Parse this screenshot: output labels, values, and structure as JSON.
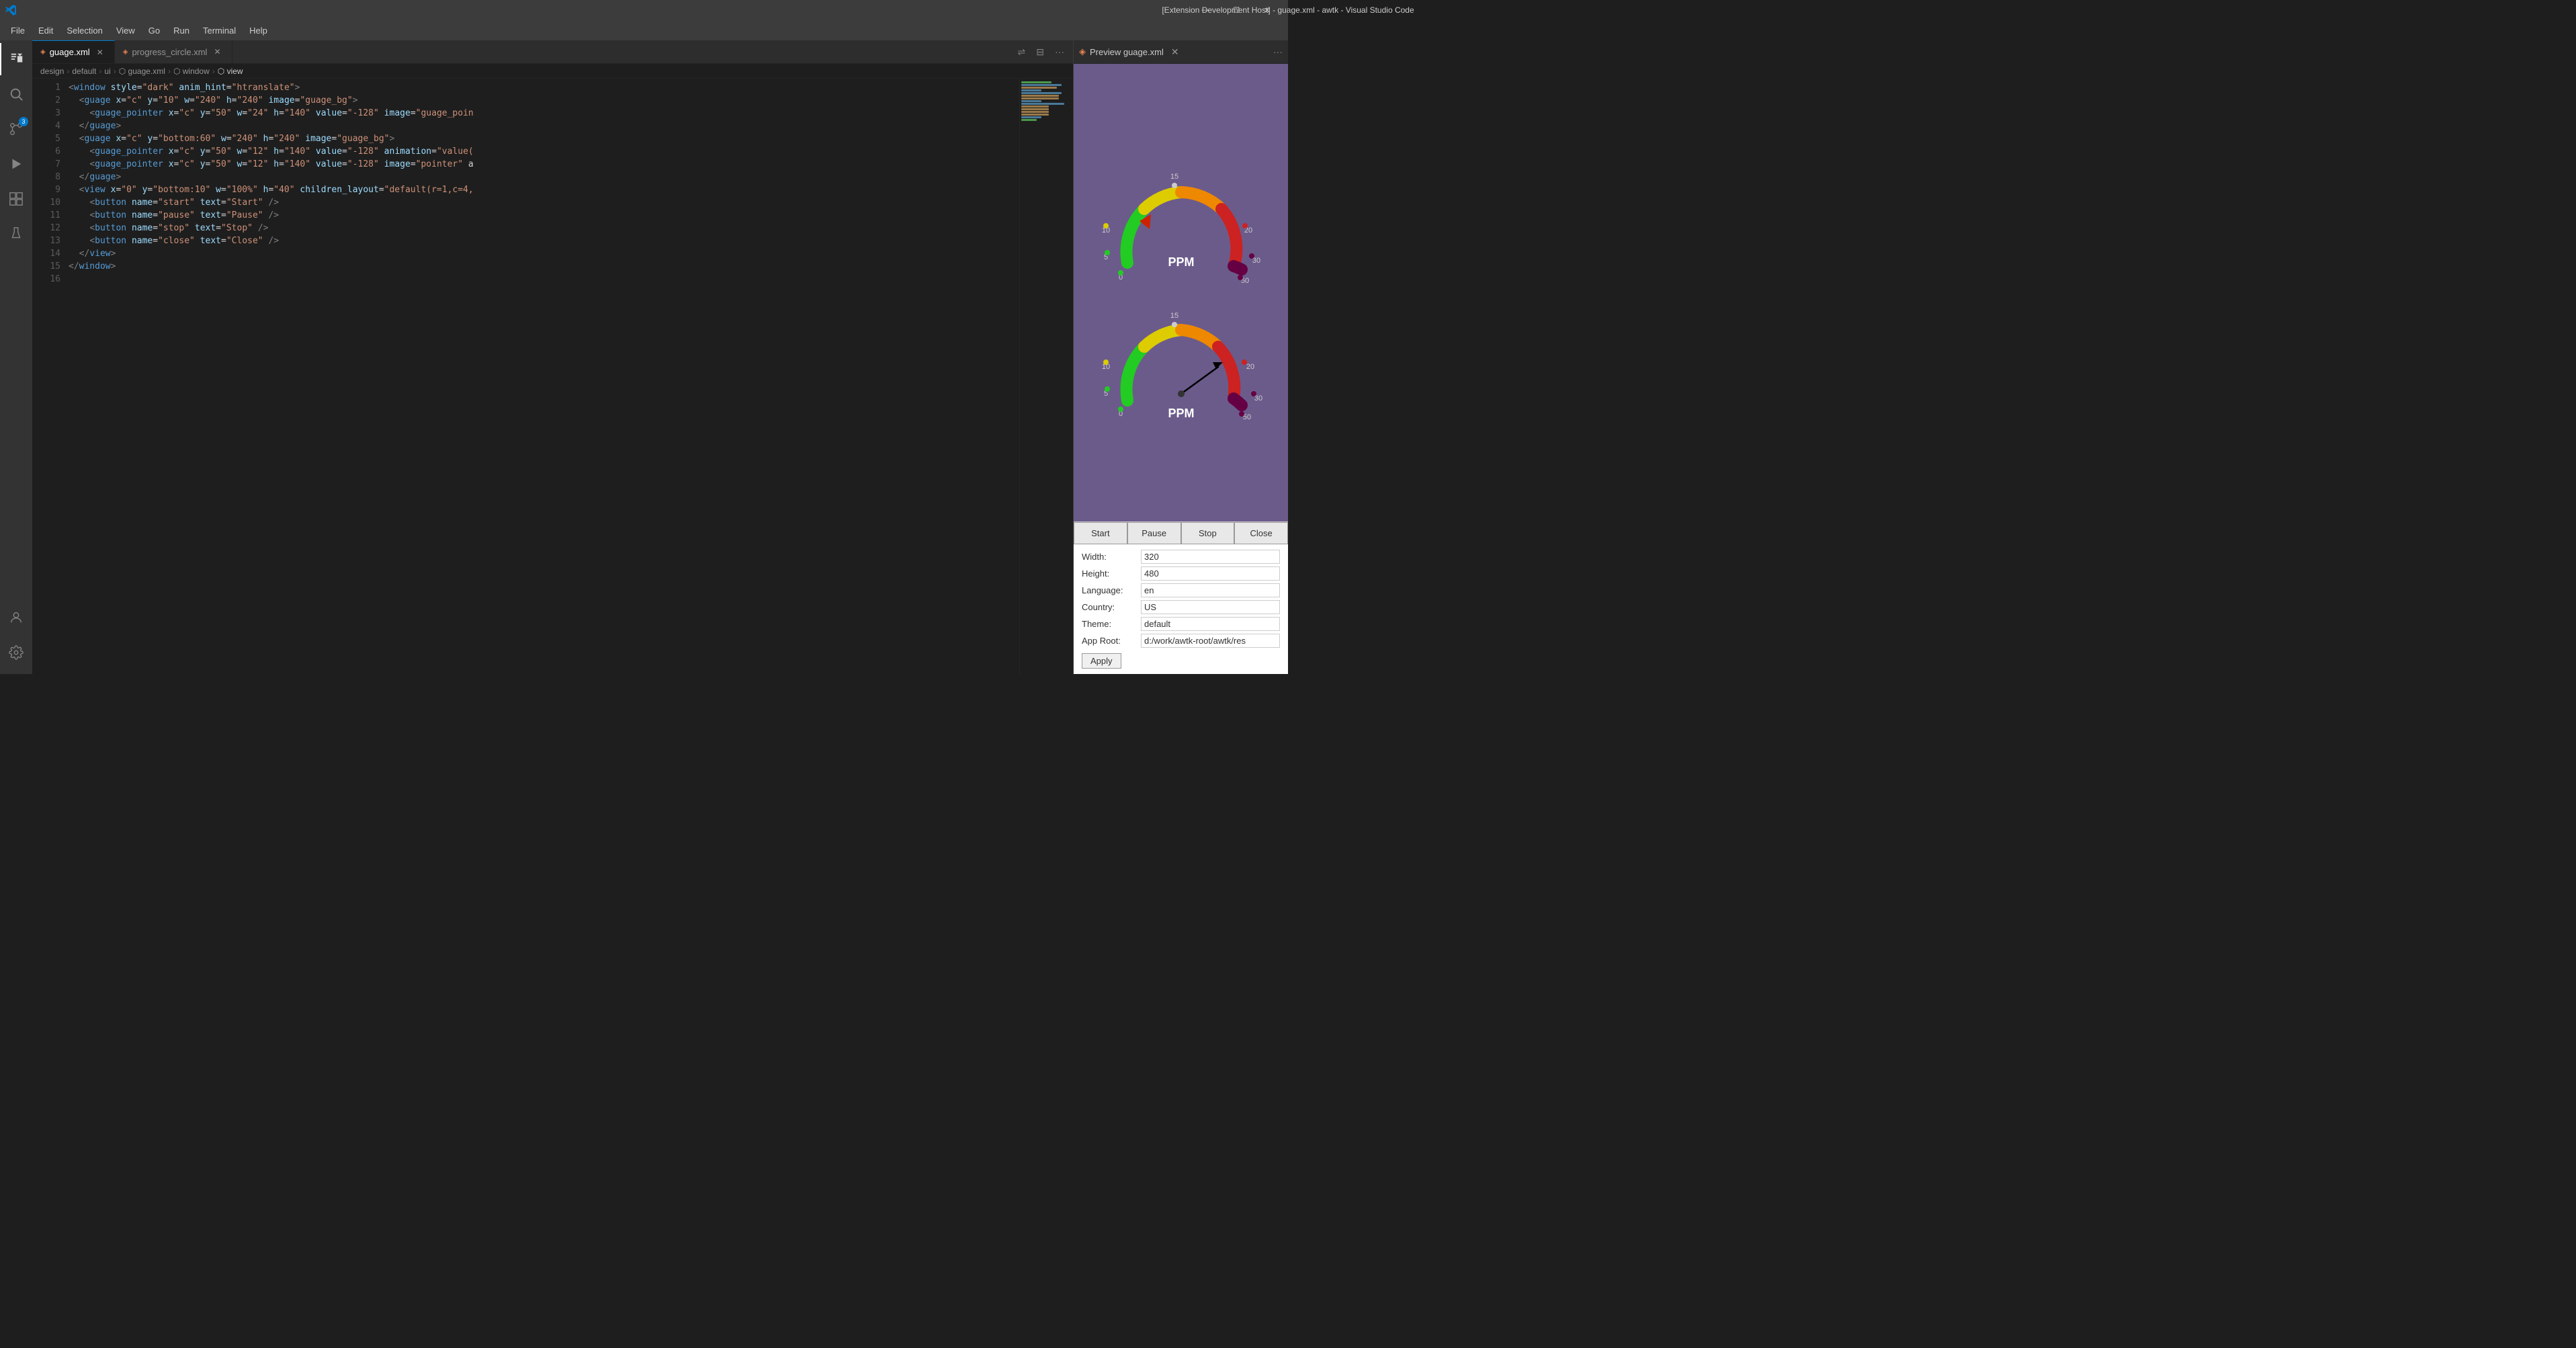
{
  "titleBar": {
    "title": "[Extension Development Host] - guage.xml - awtk - Visual Studio Code",
    "buttons": {
      "minimize": "—",
      "maximize": "❐",
      "close": "✕"
    }
  },
  "menuBar": {
    "items": [
      "File",
      "Edit",
      "Selection",
      "View",
      "Go",
      "Run",
      "Terminal",
      "Help"
    ]
  },
  "activityBar": {
    "icons": [
      {
        "name": "explorer",
        "symbol": "⬜",
        "active": true
      },
      {
        "name": "search",
        "symbol": "🔍"
      },
      {
        "name": "source-control",
        "symbol": "⎇",
        "badge": "3"
      },
      {
        "name": "run-debug",
        "symbol": "▶"
      },
      {
        "name": "extensions",
        "symbol": "⊞"
      },
      {
        "name": "testing",
        "symbol": "⚗"
      }
    ],
    "bottom": [
      {
        "name": "accounts",
        "symbol": "👤"
      },
      {
        "name": "settings",
        "symbol": "⚙"
      }
    ]
  },
  "tabs": [
    {
      "label": "guage.xml",
      "active": true,
      "modified": false
    },
    {
      "label": "progress_circle.xml",
      "active": false,
      "modified": false
    }
  ],
  "breadcrumb": [
    "design",
    "default",
    "ui",
    "guage.xml",
    "window",
    "view"
  ],
  "codeLines": [
    {
      "num": 1,
      "indent": 0,
      "content": "<window style=\"dark\" anim_hint=\"htranslate\">"
    },
    {
      "num": 2,
      "indent": 1,
      "content": "  <guage x=\"c\" y=\"10\" w=\"240\" h=\"240\" image=\"guage_bg\">"
    },
    {
      "num": 3,
      "indent": 2,
      "content": "    <guage_pointer x=\"c\" y=\"50\" w=\"24\" h=\"140\" value=\"-128\" image=\"guage_poin"
    },
    {
      "num": 4,
      "indent": 1,
      "content": "  </guage>"
    },
    {
      "num": 5,
      "indent": 1,
      "content": "  <guage x=\"c\" y=\"bottom:60\" w=\"240\" h=\"240\" image=\"guage_bg\">"
    },
    {
      "num": 6,
      "indent": 2,
      "content": "    <guage_pointer x=\"c\" y=\"50\" w=\"12\" h=\"140\" value=\"-128\" animation=\"value("
    },
    {
      "num": 7,
      "indent": 2,
      "content": "    <guage_pointer x=\"c\" y=\"50\" w=\"12\" h=\"140\" value=\"-128\" image=\"pointer\" a"
    },
    {
      "num": 8,
      "indent": 1,
      "content": "  </guage>"
    },
    {
      "num": 9,
      "indent": 1,
      "content": "  <view x=\"0\" y=\"bottom:10\" w=\"100%\" h=\"40\" children_layout=\"default(r=1,c=4,"
    },
    {
      "num": 10,
      "indent": 2,
      "content": "    <button name=\"start\" text=\"Start\" />"
    },
    {
      "num": 11,
      "indent": 2,
      "content": "    <button name=\"pause\" text=\"Pause\" />"
    },
    {
      "num": 12,
      "indent": 2,
      "content": "    <button name=\"stop\" text=\"Stop\" />"
    },
    {
      "num": 13,
      "indent": 2,
      "content": "    <button name=\"close\" text=\"Close\" />"
    },
    {
      "num": 14,
      "indent": 1,
      "content": "  </view>"
    },
    {
      "num": 15,
      "indent": 0,
      "content": "</window>"
    },
    {
      "num": 16,
      "indent": 0,
      "content": ""
    }
  ],
  "preview": {
    "title": "Preview guage.xml",
    "buttons": {
      "start": "Start",
      "pause": "Pause",
      "stop": "Stop",
      "close": "Close"
    },
    "properties": {
      "width": {
        "label": "Width:",
        "value": "320"
      },
      "height": {
        "label": "Height:",
        "value": "480"
      },
      "language": {
        "label": "Language:",
        "value": "en"
      },
      "country": {
        "label": "Country:",
        "value": "US"
      },
      "theme": {
        "label": "Theme:",
        "value": "default"
      },
      "appRoot": {
        "label": "App Root:",
        "value": "d:/work/awtk-root/awtk/res"
      }
    },
    "applyButton": "Apply"
  },
  "gauges": {
    "top": {
      "ppm": "PPM",
      "ticks": [
        "5",
        "10",
        "15",
        "20",
        "30",
        "50",
        "15",
        "0"
      ]
    },
    "bottom": {
      "ppm": "PPM",
      "ticks": [
        "5",
        "10",
        "15",
        "20",
        "30",
        "50",
        "15",
        "0"
      ]
    }
  }
}
